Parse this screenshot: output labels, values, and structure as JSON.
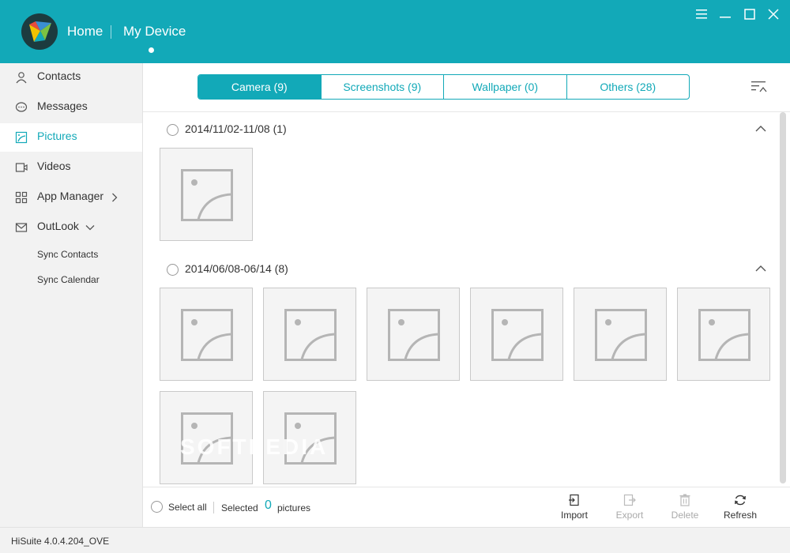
{
  "header": {
    "nav_home": "Home",
    "nav_my_device": "My Device",
    "accent_color": "#12a9b8"
  },
  "window_controls": [
    "menu-icon",
    "minimize-icon",
    "maximize-icon",
    "close-icon"
  ],
  "sidebar": {
    "items": [
      {
        "label": "Contacts",
        "icon": "person-icon"
      },
      {
        "label": "Messages",
        "icon": "chat-bubble-icon"
      },
      {
        "label": "Pictures",
        "icon": "picture-icon",
        "active": true
      },
      {
        "label": "Videos",
        "icon": "video-icon"
      },
      {
        "label": "App Manager",
        "icon": "grid-icon"
      },
      {
        "label": "OutLook",
        "icon": "envelope-icon"
      }
    ],
    "sub_items": [
      "Sync Contacts",
      "Sync Calendar"
    ]
  },
  "tabs": [
    {
      "label": "Camera (9)",
      "active": true
    },
    {
      "label": "Screenshots (9)"
    },
    {
      "label": "Wallpaper (0)"
    },
    {
      "label": "Others (28)"
    }
  ],
  "groups": [
    {
      "title": "2014/11/02-11/08  (1)",
      "count": 1
    },
    {
      "title": "2014/06/08-06/14  (8)",
      "count": 8
    }
  ],
  "bottom": {
    "select_all": "Select all",
    "selected_label": "Selected",
    "selected_count": "0",
    "pictures_label": "pictures",
    "actions": [
      {
        "label": "Import",
        "enabled": true
      },
      {
        "label": "Export",
        "enabled": false
      },
      {
        "label": "Delete",
        "enabled": false
      },
      {
        "label": "Refresh",
        "enabled": true
      }
    ]
  },
  "status": {
    "version": "HiSuite 4.0.4.204_OVE"
  },
  "watermark": "SOFTPEDIA"
}
